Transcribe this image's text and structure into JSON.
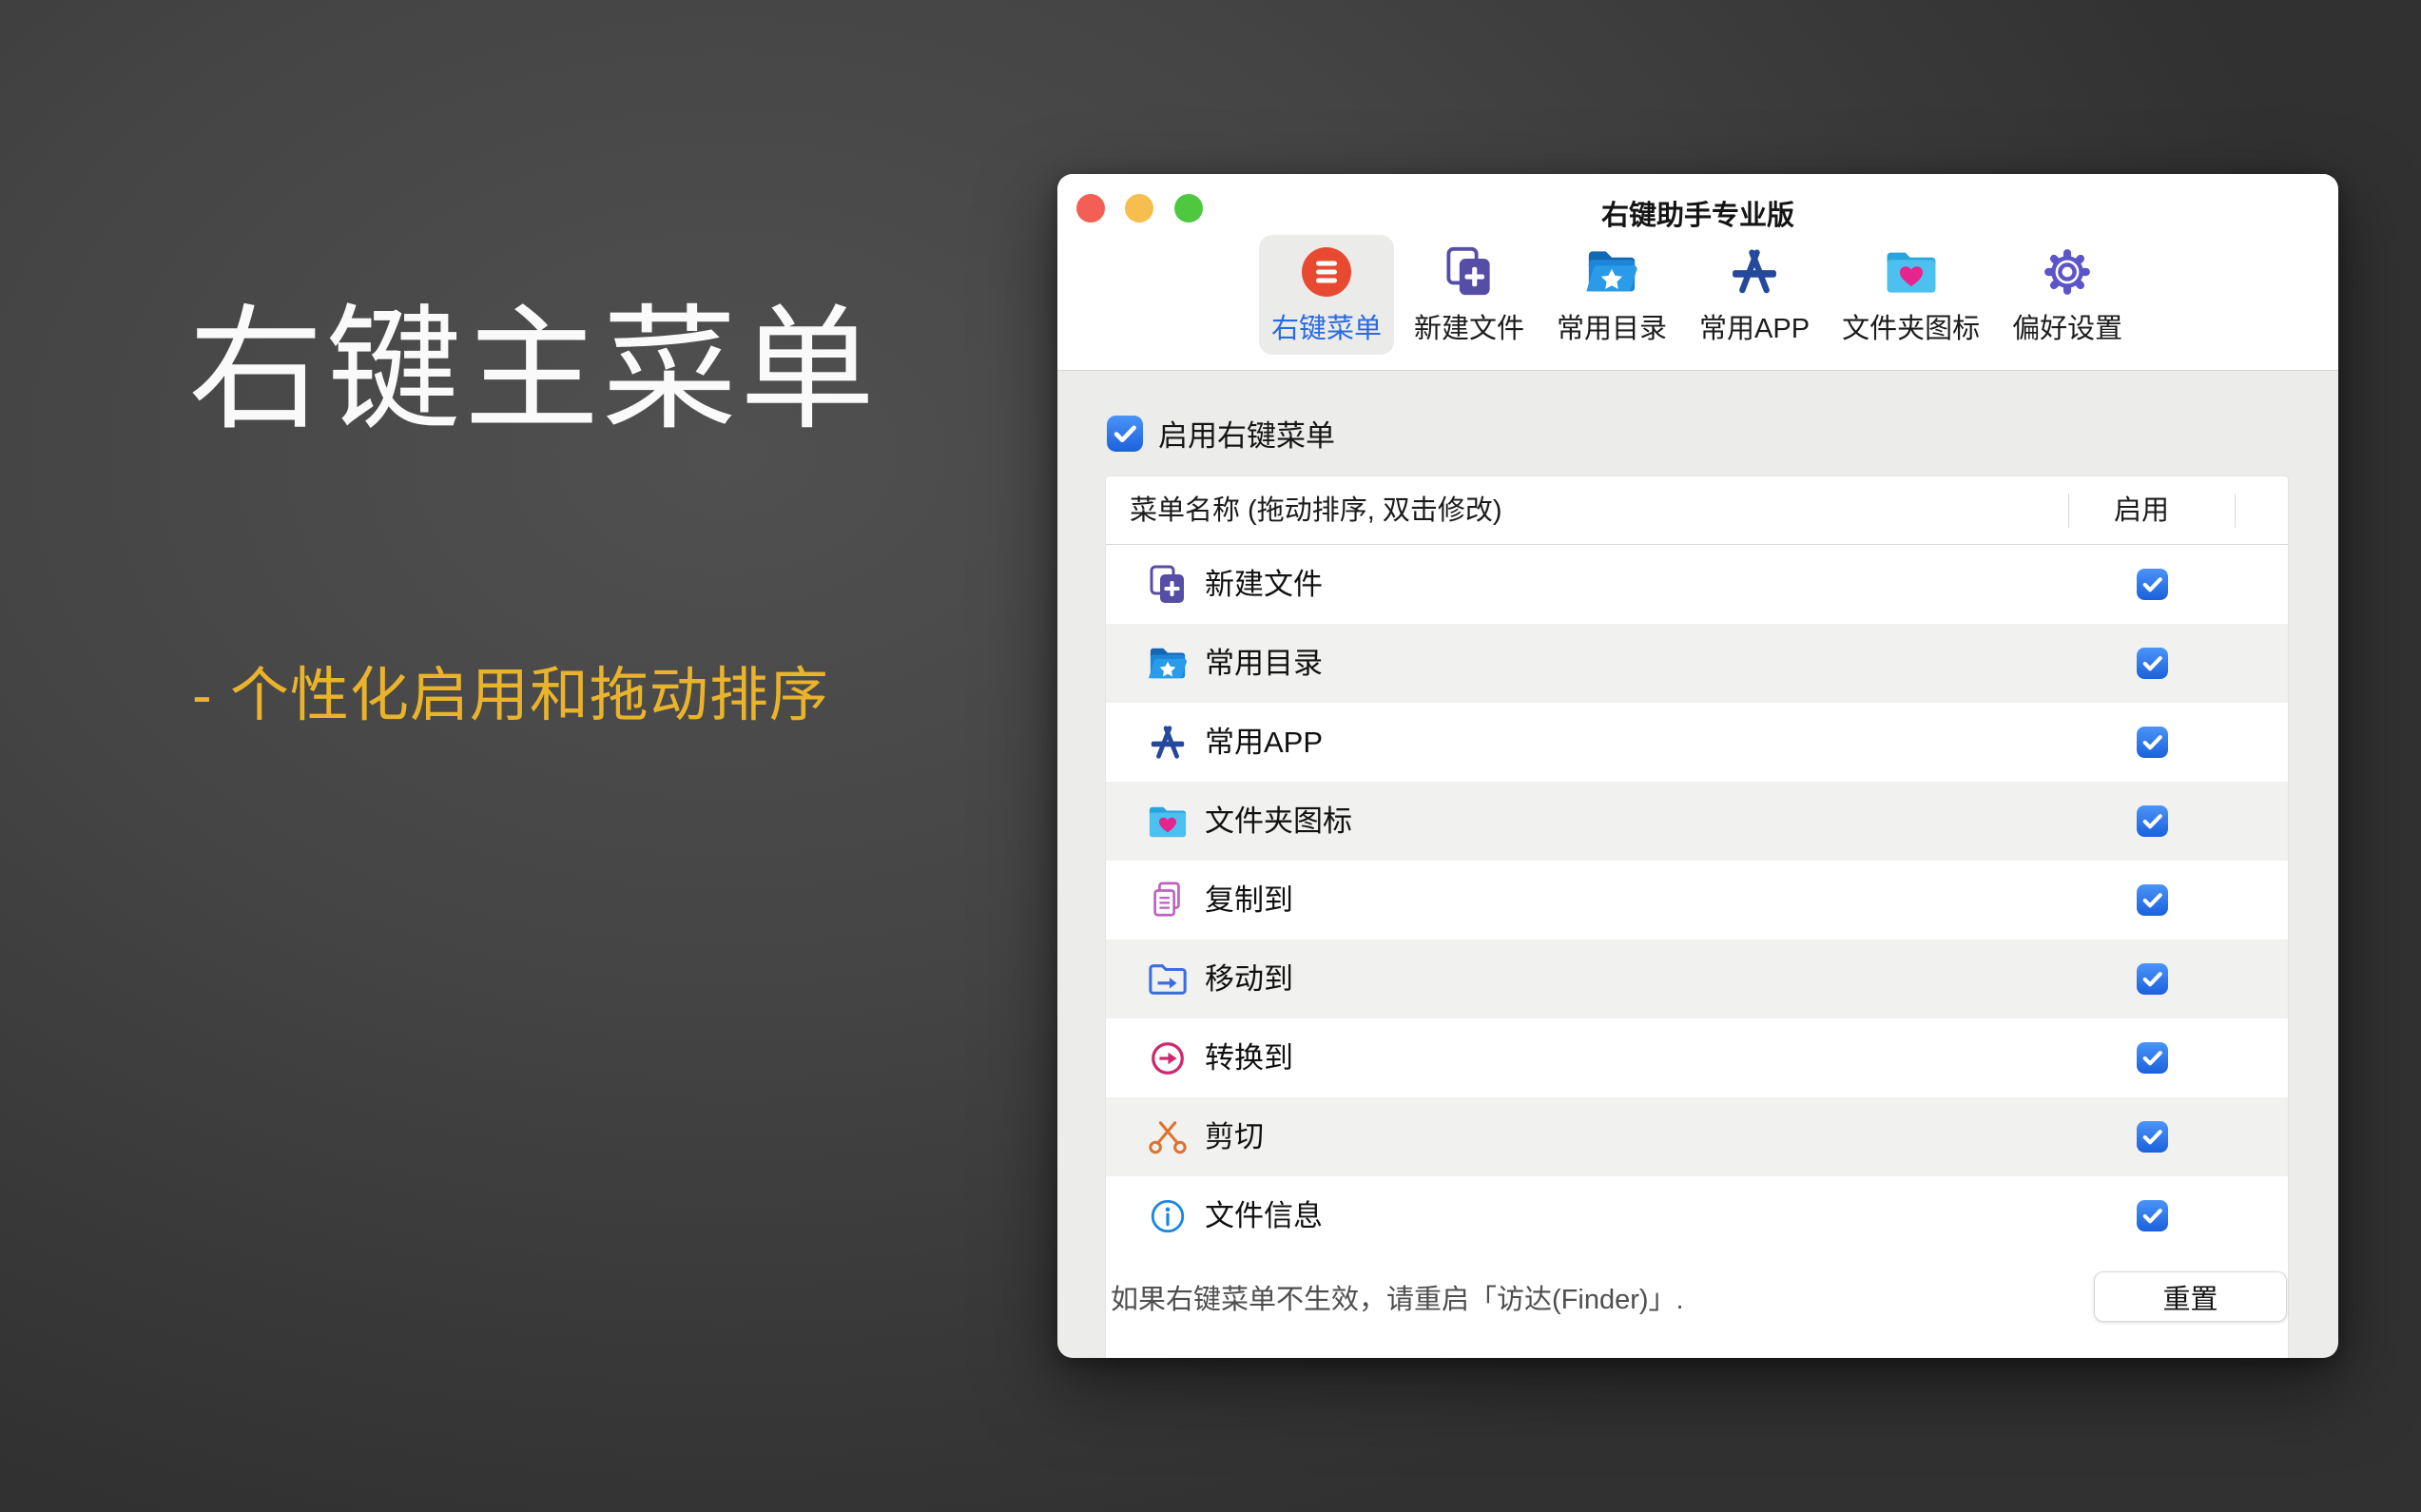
{
  "slide": {
    "headline": "右键主菜单",
    "subtitle": "- 个性化启用和拖动排序"
  },
  "window": {
    "title": "右键助手专业版",
    "toolbar": [
      {
        "label": "右键菜单",
        "icon": "menu-lines-icon",
        "selected": true
      },
      {
        "label": "新建文件",
        "icon": "new-file-icon",
        "selected": false
      },
      {
        "label": "常用目录",
        "icon": "folder-star-icon",
        "selected": false
      },
      {
        "label": "常用APP",
        "icon": "appstore-icon",
        "selected": false
      },
      {
        "label": "文件夹图标",
        "icon": "folder-heart-icon",
        "selected": false
      },
      {
        "label": "偏好设置",
        "icon": "gear-icon",
        "selected": false
      }
    ],
    "enable_checkbox": {
      "label": "启用右键菜单",
      "checked": true
    },
    "table": {
      "name_header": "菜单名称 (拖动排序, 双击修改)",
      "enable_header": "启用",
      "rows": [
        {
          "label": "新建文件",
          "icon": "new-file-icon",
          "enabled": true
        },
        {
          "label": "常用目录",
          "icon": "folder-star-icon",
          "enabled": true
        },
        {
          "label": "常用APP",
          "icon": "appstore-icon",
          "enabled": true
        },
        {
          "label": "文件夹图标",
          "icon": "folder-heart-icon",
          "enabled": true
        },
        {
          "label": "复制到",
          "icon": "copy-icon",
          "enabled": true
        },
        {
          "label": "移动到",
          "icon": "move-icon",
          "enabled": true
        },
        {
          "label": "转换到",
          "icon": "convert-icon",
          "enabled": true
        },
        {
          "label": "剪切",
          "icon": "cut-icon",
          "enabled": true
        },
        {
          "label": "文件信息",
          "icon": "info-icon",
          "enabled": true
        }
      ]
    },
    "footer": {
      "note": "如果右键菜单不生效，请重启「访达(Finder)」.",
      "reset_label": "重置"
    }
  },
  "colors": {
    "accent_blue": "#2a6ae0",
    "checkbox_blue": "#2472e6",
    "subtitle_gold": "#eab32c",
    "menu_icon_red": "#e84a31",
    "traffic_red": "#f35f54",
    "traffic_yellow": "#f6be4e",
    "traffic_green": "#4ec83f"
  }
}
